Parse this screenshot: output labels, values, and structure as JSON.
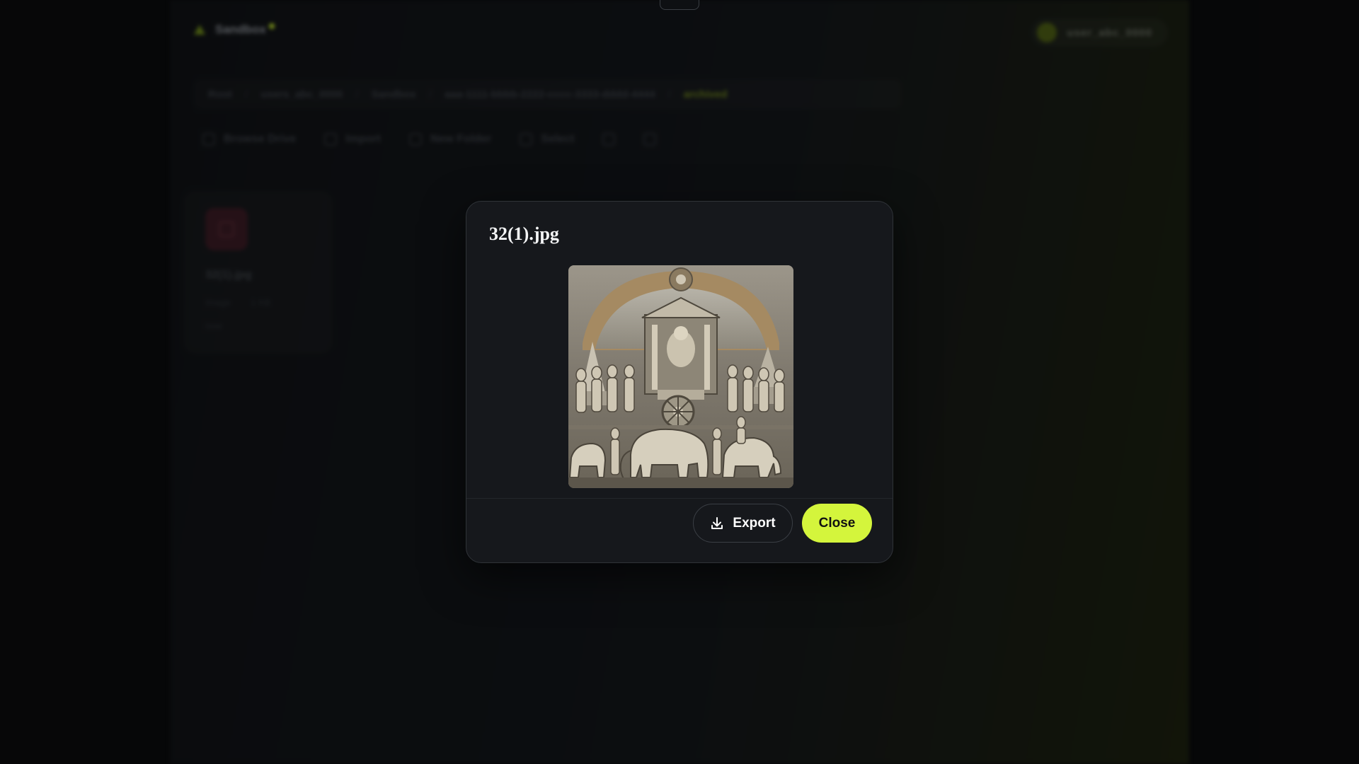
{
  "app": {
    "brand": "Sandbox",
    "account_label": "user_abc_0000",
    "breadcrumb": [
      "Root",
      "users_abc_0000",
      "Sandbox",
      "aaa-1111-bbbb-2222-cccc-3333-dddd-4444",
      "archived"
    ],
    "toolbar": {
      "browse_label": "Browse Drive",
      "import_label": "Import",
      "new_folder_label": "New Folder",
      "select_label": "Select"
    },
    "file_card": {
      "name": "32(1).jpg",
      "meta_type": "Image",
      "meta_size": "1 KB",
      "meta_date": "now"
    }
  },
  "modal": {
    "title": "32(1).jpg",
    "export_label": "Export",
    "close_label": "Close",
    "preview_alt": "32(1).jpg",
    "icons": {
      "export": "download-icon"
    }
  },
  "colors": {
    "accent": "#d4f53c",
    "modal_bg": "#16181c",
    "page_bg": "#0a0b0d"
  }
}
